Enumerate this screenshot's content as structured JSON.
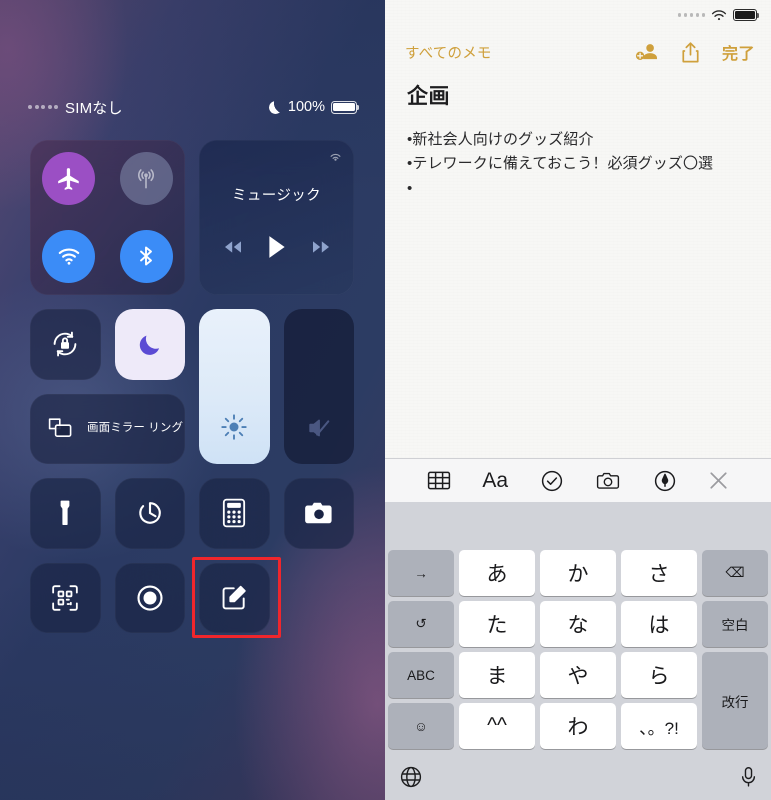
{
  "control_center": {
    "status_bar": {
      "carrier": "SIMなし",
      "battery_percent": "100%",
      "dnd_icon": "moon-icon",
      "signal_icon": "signal-dots-icon",
      "battery_icon": "battery-full-icon"
    },
    "connectivity": {
      "airplane_mode": {
        "icon": "airplane-icon",
        "active": true
      },
      "cellular_data": {
        "icon": "cellular-antenna-icon",
        "active": false
      },
      "wifi": {
        "icon": "wifi-icon",
        "active": true
      },
      "bluetooth": {
        "icon": "bluetooth-icon",
        "active": true
      }
    },
    "music": {
      "title": "ミュージック",
      "airplay_icon": "airplay-icon",
      "rewind_icon": "rewind-icon",
      "play_icon": "play-icon",
      "forward_icon": "fast-forward-icon"
    },
    "toggles": {
      "rotation_lock": {
        "icon": "rotation-lock-icon",
        "active": false
      },
      "do_not_disturb": {
        "icon": "moon-icon",
        "active": true
      },
      "screen_mirroring": {
        "label": "画面ミラー\nリング",
        "icon": "screen-mirroring-icon"
      },
      "brightness": {
        "icon": "brightness-icon",
        "level": "100"
      },
      "volume": {
        "icon": "volume-mute-icon",
        "level": "0",
        "muted": true
      }
    },
    "utilities": [
      {
        "name": "flashlight",
        "icon": "flashlight-icon"
      },
      {
        "name": "timer",
        "icon": "timer-icon"
      },
      {
        "name": "calculator",
        "icon": "calculator-icon"
      },
      {
        "name": "camera",
        "icon": "camera-icon"
      },
      {
        "name": "qr-scanner",
        "icon": "qr-code-icon"
      },
      {
        "name": "screen-recording",
        "icon": "record-icon"
      },
      {
        "name": "notes",
        "icon": "compose-note-icon",
        "highlighted": true
      }
    ],
    "highlight_color": "#f0262c"
  },
  "notes": {
    "status_bar": {
      "signal_icon": "signal-dots-icon",
      "wifi_icon": "wifi-icon",
      "battery_icon": "battery-full-icon"
    },
    "header": {
      "back_label": "すべてのメモ",
      "collaborate_icon": "add-person-icon",
      "share_icon": "share-icon",
      "done_label": "完了",
      "accent_color": "#cfa03c"
    },
    "title": "企画",
    "body_lines": [
      "•新社会人向けのグッズ紹介",
      "•テレワークに備えておこう！必須グッズ〇選",
      "•"
    ]
  },
  "keyboard": {
    "toolbar": [
      {
        "name": "table",
        "icon": "table-icon"
      },
      {
        "name": "format",
        "icon": "format-aa-icon",
        "label": "Aa"
      },
      {
        "name": "checklist",
        "icon": "checklist-icon"
      },
      {
        "name": "camera",
        "icon": "camera-icon"
      },
      {
        "name": "markup",
        "icon": "markup-pen-icon"
      },
      {
        "name": "close",
        "icon": "close-icon"
      }
    ],
    "rows": [
      [
        {
          "label": "→",
          "type": "gray",
          "name": "cursor-right-key"
        },
        {
          "label": "あ",
          "type": "white",
          "name": "kana-a-key"
        },
        {
          "label": "か",
          "type": "white",
          "name": "kana-ka-key"
        },
        {
          "label": "さ",
          "type": "white",
          "name": "kana-sa-key"
        },
        {
          "label": "⌫",
          "type": "gray",
          "name": "backspace-key"
        }
      ],
      [
        {
          "label": "↺",
          "type": "gray",
          "name": "undo-key"
        },
        {
          "label": "た",
          "type": "white",
          "name": "kana-ta-key"
        },
        {
          "label": "な",
          "type": "white",
          "name": "kana-na-key"
        },
        {
          "label": "は",
          "type": "white",
          "name": "kana-ha-key"
        },
        {
          "label": "空白",
          "type": "gray",
          "name": "space-key"
        }
      ],
      [
        {
          "label": "ABC",
          "type": "gray",
          "name": "abc-key"
        },
        {
          "label": "ま",
          "type": "white",
          "name": "kana-ma-key"
        },
        {
          "label": "や",
          "type": "white",
          "name": "kana-ya-key"
        },
        {
          "label": "ら",
          "type": "white",
          "name": "kana-ra-key"
        },
        {
          "label": "改行",
          "type": "gray",
          "name": "return-key"
        }
      ],
      [
        {
          "label": "☺",
          "type": "gray",
          "name": "emoji-key"
        },
        {
          "label": "^^",
          "type": "white",
          "name": "caret-key"
        },
        {
          "label": "わ",
          "type": "white",
          "name": "kana-wa-key"
        },
        {
          "label": "、。?!",
          "type": "white",
          "name": "punctuation-key"
        }
      ]
    ],
    "bottom": {
      "globe_icon": "globe-icon",
      "mic_icon": "microphone-icon"
    }
  }
}
